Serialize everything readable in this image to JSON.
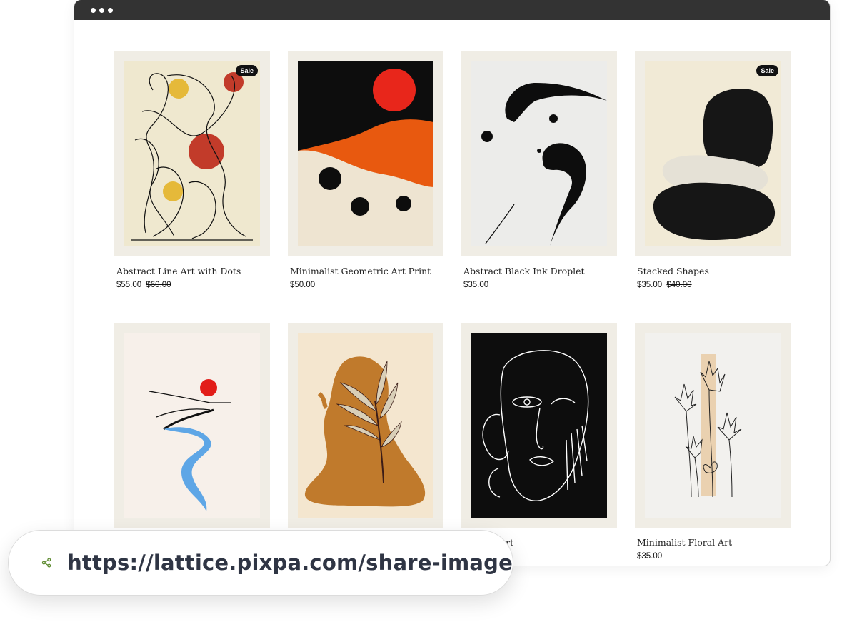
{
  "products": [
    {
      "title": "Abstract Line Art with Dots",
      "price": "$55.00",
      "old_price": "$60.00",
      "badge": "Sale"
    },
    {
      "title": "Minimalist Geometric Art Print",
      "price": "$50.00",
      "old_price": "",
      "badge": ""
    },
    {
      "title": "Abstract Black Ink Droplet",
      "price": "$35.00",
      "old_price": "",
      "badge": ""
    },
    {
      "title": "Stacked Shapes",
      "price": "$35.00",
      "old_price": "$40.00",
      "badge": "Sale"
    },
    {
      "title": "",
      "price": "",
      "old_price": "",
      "badge": ""
    },
    {
      "title": "",
      "price": "",
      "old_price": "",
      "badge": ""
    },
    {
      "title": "ce Line Art",
      "price": "",
      "old_price": "",
      "badge": ""
    },
    {
      "title": "Minimalist Floral Art",
      "price": "$35.00",
      "old_price": "",
      "badge": ""
    }
  ],
  "share": {
    "url": "https://lattice.pixpa.com/share-image",
    "icon": "share-icon",
    "accent": "#5c8a2e"
  },
  "colors": {
    "titlebar": "#333333",
    "frame": "#f0ede5",
    "badge": "#111111"
  }
}
